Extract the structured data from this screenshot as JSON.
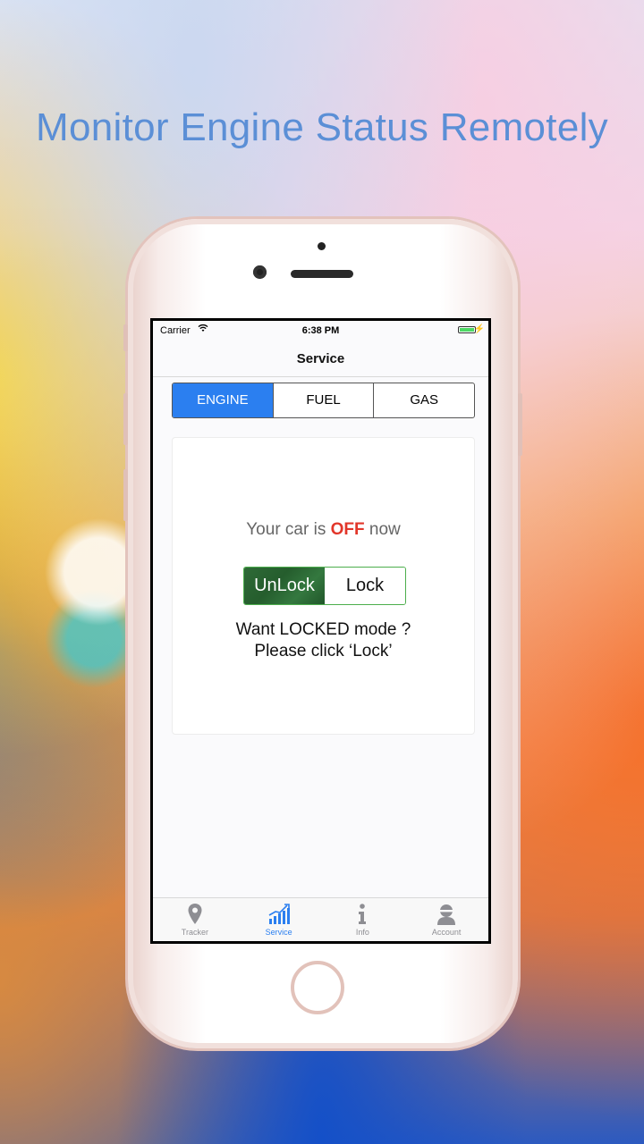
{
  "headline": "Monitor Engine Status Remotely",
  "status_bar": {
    "carrier": "Carrier",
    "time": "6:38 PM"
  },
  "nav": {
    "title": "Service"
  },
  "segments": [
    {
      "label": "ENGINE",
      "active": true
    },
    {
      "label": "FUEL",
      "active": false
    },
    {
      "label": "GAS",
      "active": false
    }
  ],
  "engine": {
    "status_prefix": "Your car is",
    "status_value": "OFF",
    "status_suffix": "now",
    "unlock_label": "UnLock",
    "lock_label": "Lock",
    "hint_line1": "Want LOCKED mode ?",
    "hint_line2": "Please click ‘Lock’"
  },
  "tabs": [
    {
      "label": "Tracker",
      "icon": "location-pin-icon"
    },
    {
      "label": "Service",
      "icon": "chart-icon"
    },
    {
      "label": "Info",
      "icon": "info-icon"
    },
    {
      "label": "Account",
      "icon": "user-icon"
    }
  ],
  "colors": {
    "accent": "#2b7ff0",
    "off": "#e2362a",
    "lock_active": "#2e6a37",
    "headline": "#5b8fd6"
  }
}
